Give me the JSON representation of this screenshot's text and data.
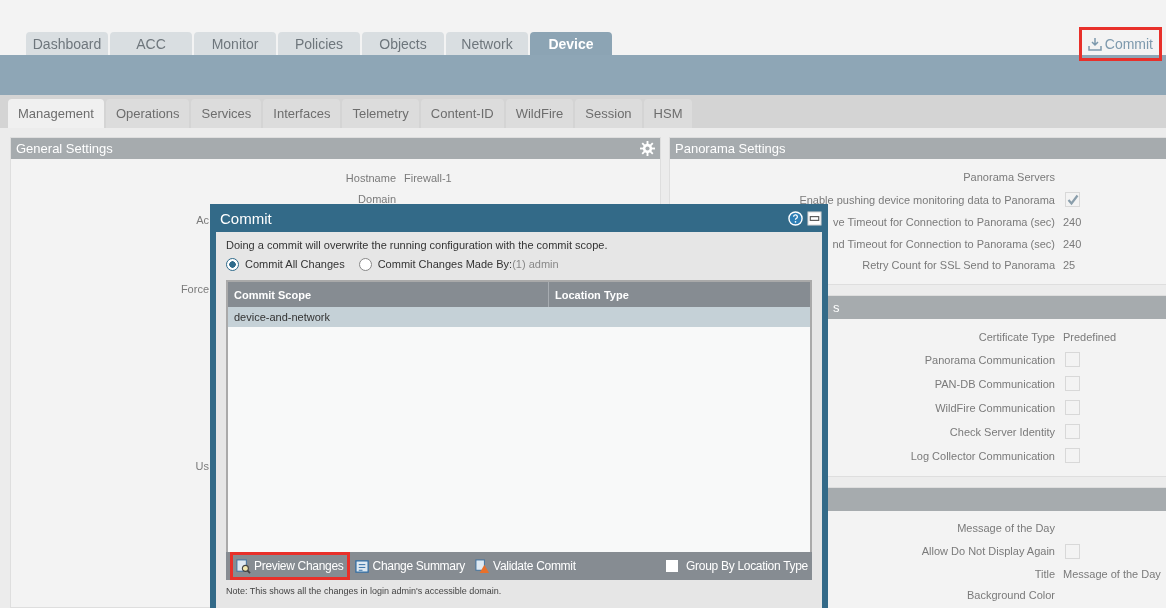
{
  "top_tabs": [
    {
      "label": "Dashboard",
      "selected": false
    },
    {
      "label": "ACC",
      "selected": false
    },
    {
      "label": "Monitor",
      "selected": false
    },
    {
      "label": "Policies",
      "selected": false
    },
    {
      "label": "Objects",
      "selected": false
    },
    {
      "label": "Network",
      "selected": false
    },
    {
      "label": "Device",
      "selected": true
    }
  ],
  "commit_link": {
    "label": "Commit",
    "highlighted": true
  },
  "sub_tabs": [
    {
      "label": "Management",
      "selected": true
    },
    {
      "label": "Operations",
      "selected": false
    },
    {
      "label": "Services",
      "selected": false
    },
    {
      "label": "Interfaces",
      "selected": false
    },
    {
      "label": "Telemetry",
      "selected": false
    },
    {
      "label": "Content-ID",
      "selected": false
    },
    {
      "label": "WildFire",
      "selected": false
    },
    {
      "label": "Session",
      "selected": false
    },
    {
      "label": "HSM",
      "selected": false
    }
  ],
  "general_settings": {
    "title": "General Settings",
    "rows": [
      {
        "kind": "field",
        "label": "Hostname",
        "value": "Firewall-1"
      },
      {
        "kind": "field",
        "label": "Domain"
      },
      {
        "kind": "covered",
        "label": "Ac"
      },
      {
        "kind": "covered",
        "label": "Force"
      },
      {
        "kind": "covered",
        "label": "Us"
      }
    ]
  },
  "right_panels": [
    {
      "title": "Panorama Settings",
      "rows": [
        {
          "kind": "text",
          "label": "Panorama Servers"
        },
        {
          "kind": "checkbox",
          "label": "Enable pushing device monitoring data to Panorama",
          "checked": true
        },
        {
          "kind": "text",
          "label": "ve Timeout for Connection to Panorama (sec)",
          "value": "240"
        },
        {
          "kind": "text",
          "label": "nd Timeout for Connection to Panorama (sec)",
          "value": "240"
        },
        {
          "kind": "text",
          "label": "Retry Count for SSL Send to Panorama",
          "value": "25"
        }
      ]
    },
    {
      "title": "s",
      "rows": [
        {
          "kind": "text",
          "label": "Certificate Type",
          "value": "Predefined"
        },
        {
          "kind": "checkbox",
          "label": "Panorama Communication",
          "checked": false
        },
        {
          "kind": "checkbox",
          "label": "PAN-DB Communication",
          "checked": false
        },
        {
          "kind": "checkbox",
          "label": "WildFire Communication",
          "checked": false
        },
        {
          "kind": "checkbox",
          "label": "Check Server Identity",
          "checked": false
        },
        {
          "kind": "checkbox",
          "label": "Log Collector Communication",
          "checked": false
        }
      ]
    },
    {
      "rows": [
        {
          "kind": "text",
          "label": "Message of the Day"
        },
        {
          "kind": "checkbox",
          "label": "Allow Do Not Display Again",
          "checked": false
        },
        {
          "kind": "text",
          "label": "Title",
          "value": "Message of the Day"
        },
        {
          "kind": "text",
          "label": "Background Color"
        }
      ]
    }
  ],
  "commit_dialog": {
    "title": "Commit",
    "description": "Doing a commit will overwrite the running configuration with the commit scope.",
    "options": [
      {
        "label": "Commit All Changes",
        "selected": true
      },
      {
        "label": "Commit Changes Made By:",
        "suffix": "(1) admin",
        "selected": false
      }
    ],
    "table": {
      "columns": [
        "Commit Scope",
        "Location Type"
      ],
      "rows": [
        {
          "commit_scope": "device-and-network",
          "selected": true
        }
      ]
    },
    "toolbar": [
      {
        "label": "Preview Changes",
        "highlighted": true
      },
      {
        "label": "Change Summary",
        "highlighted": false
      },
      {
        "label": "Validate Commit",
        "highlighted": false
      }
    ],
    "group_by": {
      "label": "Group By Location Type",
      "checked": false
    },
    "note": "Note: This shows all the changes in login admin's accessible domain."
  }
}
